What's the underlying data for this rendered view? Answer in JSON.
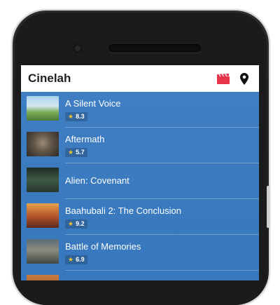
{
  "app": {
    "title": "Cinelah"
  },
  "toolbar": {
    "icons": [
      "clapperboard-icon",
      "map-pin-icon"
    ],
    "accent": "#e8344a"
  },
  "movies": [
    {
      "title": "A Silent Voice",
      "rating": "8.3"
    },
    {
      "title": "Aftermath",
      "rating": "5.7"
    },
    {
      "title": "Alien: Covenant",
      "rating": ""
    },
    {
      "title": "Baahubali 2: The Conclusion",
      "rating": "9.2"
    },
    {
      "title": "Battle of Memories",
      "rating": "6.9"
    },
    {
      "title": "",
      "rating": ""
    }
  ],
  "colors": {
    "list_background": "#3b7bc0",
    "star": "#f2c230"
  }
}
